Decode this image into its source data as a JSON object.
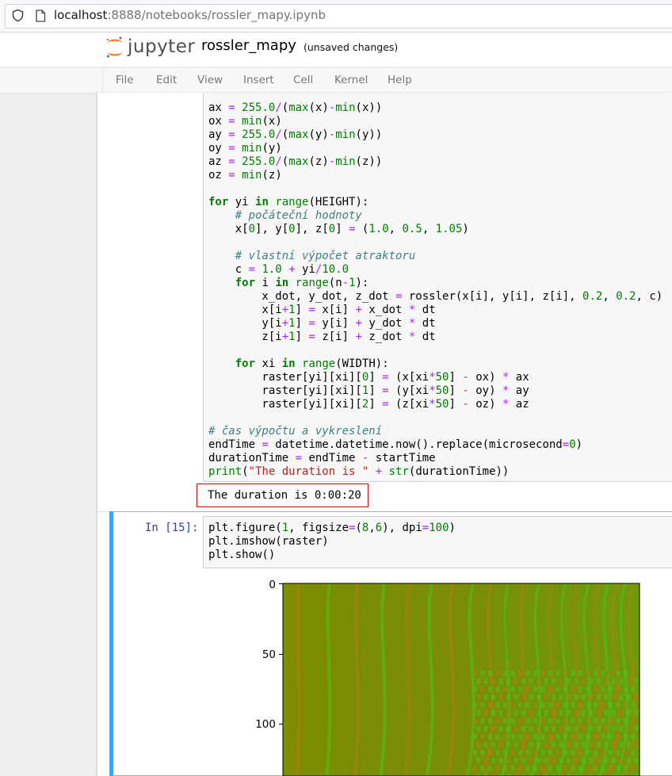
{
  "browser": {
    "url_host": "localhost",
    "url_rest": ":8888/notebooks/rossler_mapy.ipynb"
  },
  "header": {
    "logo_text": "jupyter",
    "notebook_name": "rossler_mapy",
    "save_status": "(unsaved changes)"
  },
  "menubar": {
    "items": [
      "File",
      "Edit",
      "View",
      "Insert",
      "Cell",
      "Kernel",
      "Help"
    ]
  },
  "cells": {
    "code1_lines": [
      "ax = 255.0/(max(x)-min(x))",
      "ox = min(x)",
      "ay = 255.0/(max(y)-min(y))",
      "oy = min(y)",
      "az = 255.0/(max(z)-min(z))",
      "oz = min(z)",
      "",
      "for yi in range(HEIGHT):",
      "    # počáteční hodnoty",
      "    x[0], y[0], z[0] = (1.0, 0.5, 1.05)",
      "",
      "    # vlastní výpočet atraktoru",
      "    c = 1.0 + yi/10.0",
      "    for i in range(n-1):",
      "        x_dot, y_dot, z_dot = rossler(x[i], y[i], z[i], 0.2, 0.2, c)",
      "        x[i+1] = x[i] + x_dot * dt",
      "        y[i+1] = y[i] + y_dot * dt",
      "        z[i+1] = z[i] + z_dot * dt",
      "",
      "    for xi in range(WIDTH):",
      "        raster[yi][xi][0] = (x[xi*50] - ox) * ax",
      "        raster[yi][xi][1] = (y[xi*50] - oy) * ay",
      "        raster[yi][xi][2] = (z[xi*50] - oz) * az",
      "",
      "# čas výpočtu a vykreslení",
      "endTime = datetime.datetime.now().replace(microsecond=0)",
      "durationTime = endTime - startTime",
      "print(\"The duration is \" + str(durationTime))"
    ],
    "output1": "The duration is 0:00:20",
    "prompt2": "In [15]:",
    "code2_lines": [
      "plt.figure(1, figsize=(8,6), dpi=100)",
      "plt.imshow(raster)",
      "plt.show()"
    ]
  },
  "plot": {
    "y_ticks": [
      "0",
      "50",
      "100"
    ],
    "colors": {
      "base": "#7f8c00",
      "orange": "#c07a10",
      "green": "#40d020"
    }
  }
}
